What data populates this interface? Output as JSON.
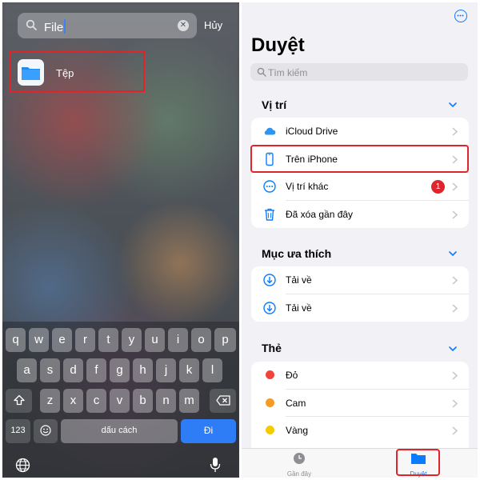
{
  "left": {
    "search": {
      "value": "File",
      "cancel_label": "Hủy"
    },
    "result": {
      "label": "Tệp"
    },
    "keyboard": {
      "row1": [
        "q",
        "w",
        "e",
        "r",
        "t",
        "y",
        "u",
        "i",
        "o",
        "p"
      ],
      "row2": [
        "a",
        "s",
        "d",
        "f",
        "g",
        "h",
        "j",
        "k",
        "l"
      ],
      "row3": [
        "z",
        "x",
        "c",
        "v",
        "b",
        "n",
        "m"
      ],
      "numbers_label": "123",
      "space_label": "dấu cách",
      "go_label": "Đi"
    }
  },
  "right": {
    "title": "Duyệt",
    "search_placeholder": "Tìm kiếm",
    "locations": {
      "heading": "Vị trí",
      "items": [
        {
          "label": "iCloud Drive",
          "icon": "cloud-icon"
        },
        {
          "label": "Trên iPhone",
          "icon": "iphone-icon"
        },
        {
          "label": "Vị trí khác",
          "icon": "ellipsis-circle-icon",
          "badge": "1"
        },
        {
          "label": "Đã xóa gần đây",
          "icon": "trash-icon"
        }
      ]
    },
    "favorites": {
      "heading": "Mục ưa thích",
      "items": [
        {
          "label": "Tải về",
          "icon": "download-icon"
        },
        {
          "label": "Tải về",
          "icon": "download-icon"
        }
      ]
    },
    "tags": {
      "heading": "Thẻ",
      "items": [
        {
          "label": "Đỏ",
          "color": "#f0443a"
        },
        {
          "label": "Cam",
          "color": "#f59a23"
        },
        {
          "label": "Vàng",
          "color": "#f5cc00"
        }
      ]
    },
    "tabbar": {
      "recents_label": "Gần đây",
      "browse_label": "Duyệt"
    },
    "colors": {
      "accent": "#0a7cff",
      "highlight": "#e0242b"
    }
  }
}
